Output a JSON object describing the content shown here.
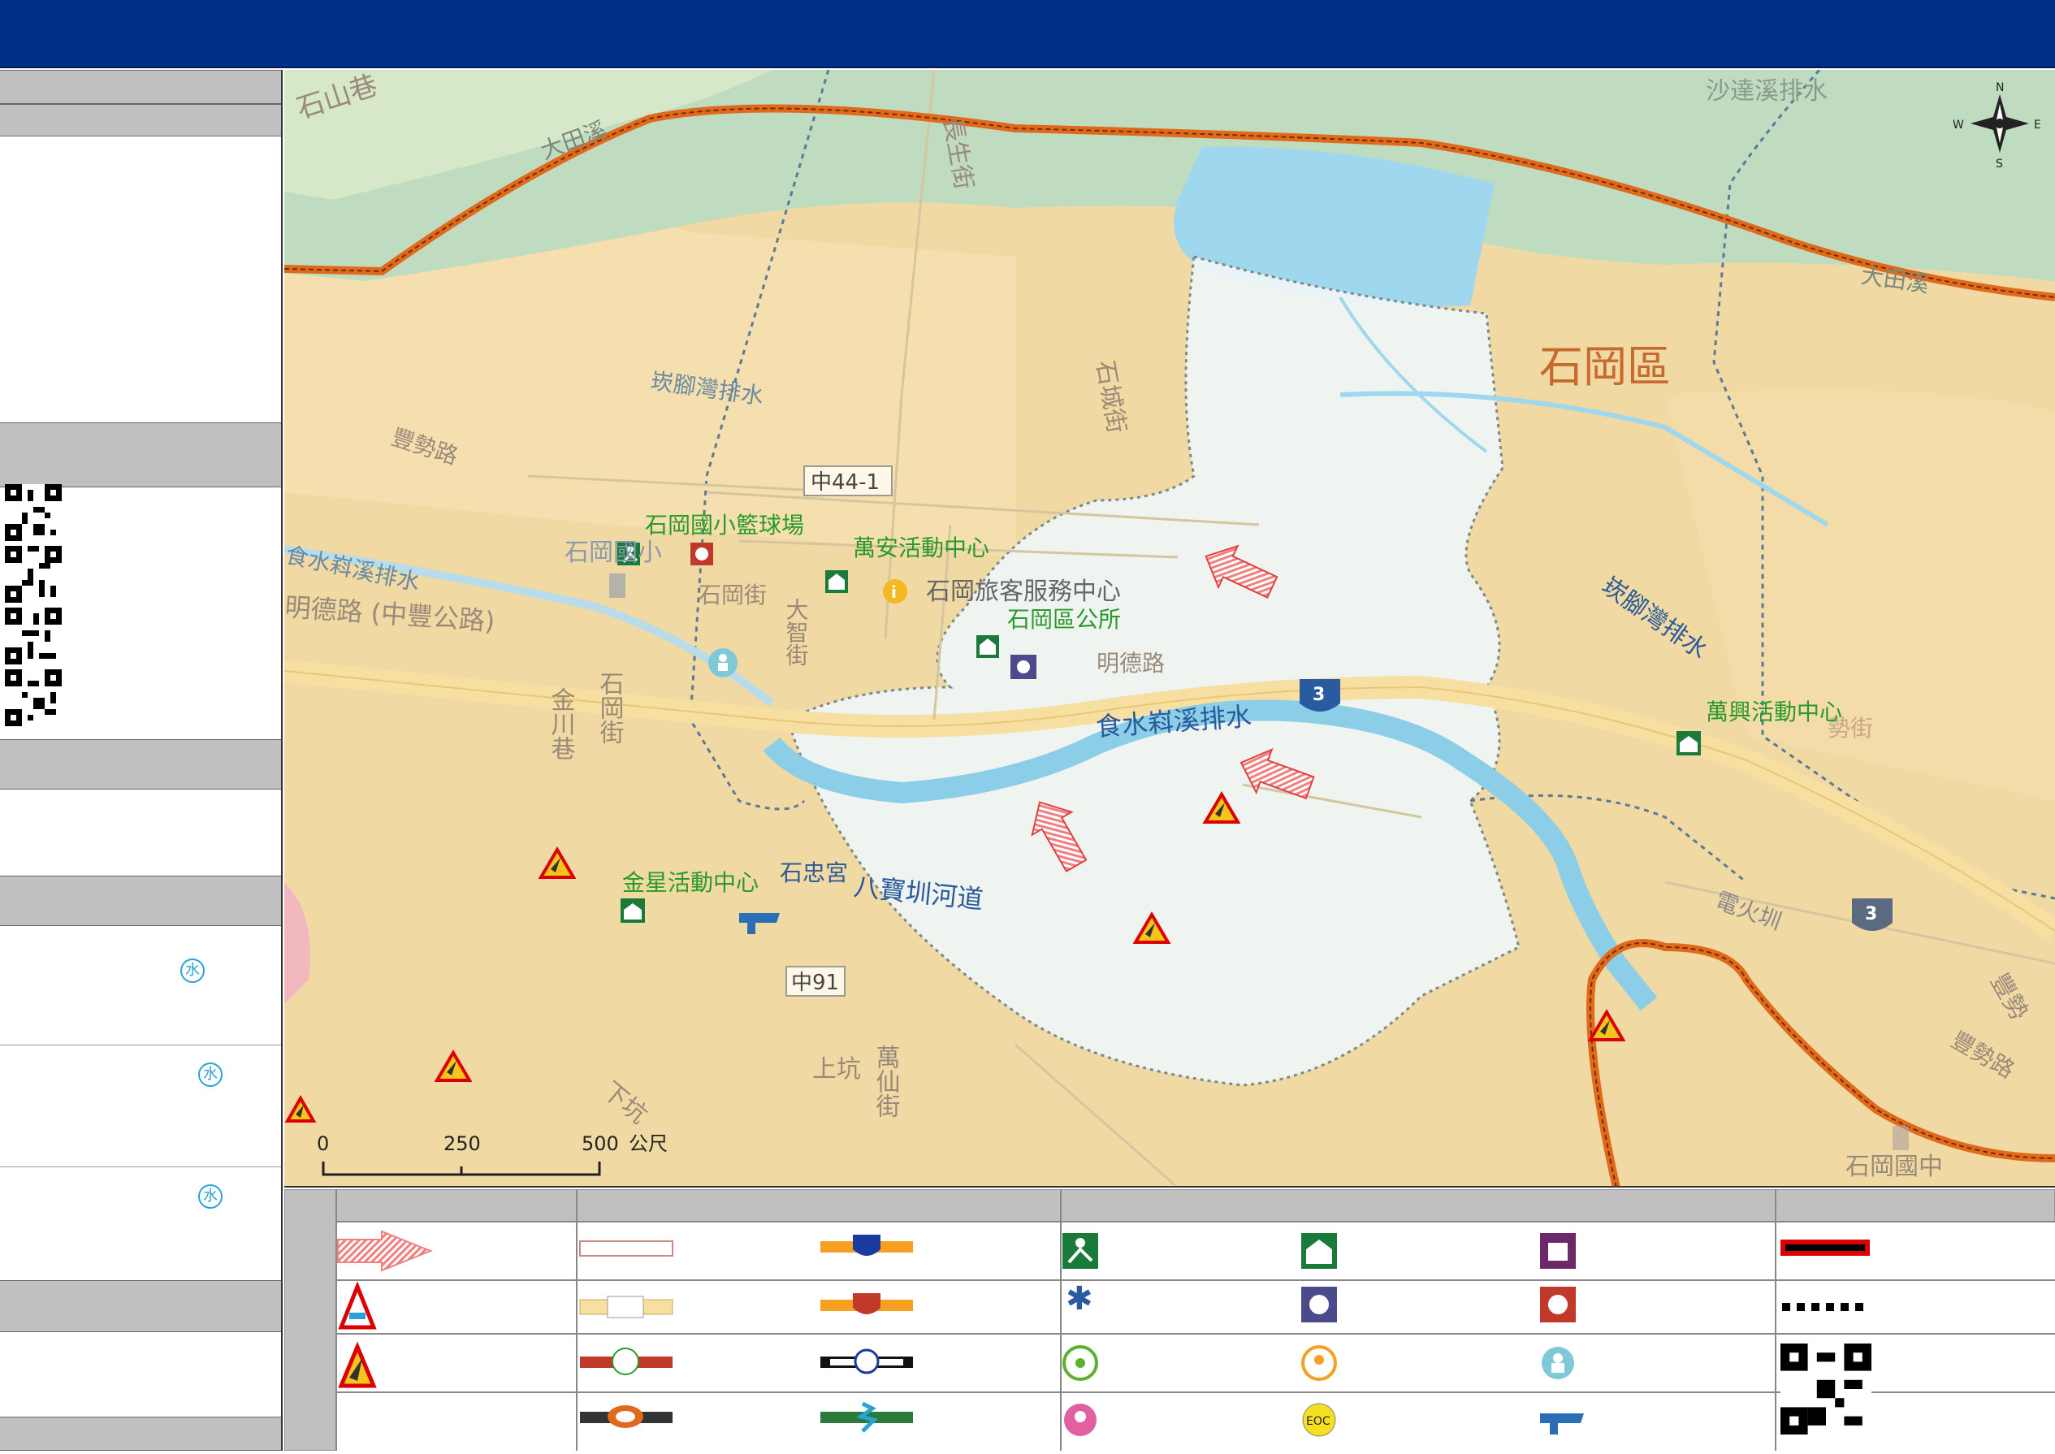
{
  "map": {
    "place_labels": {
      "shigang_district": "石岡區",
      "shishan_lane": "石山巷",
      "datian_creek_w": "大田溪",
      "datian_creek_e": "大田溪",
      "shadaxi": "沙達溪排水",
      "changsheng_st": "長生街",
      "shicheng_st": "石城街",
      "zhong44": "中44-1",
      "fengshi_rd": "豐勢路",
      "kanjiaowan_w": "崁腳灣排水",
      "kanjiaowan_e": "崁腳灣排水",
      "shishui_w": "食水嵙溪排水",
      "shishui_main": "食水嵙溪排水",
      "mingde_rd": "明德路 (中豐公路)",
      "shigang_st": "石岡街",
      "dazhi_st": "大智街",
      "jinchuan_lane": "金川巷",
      "shigang_st2": "石岡街",
      "shigang_es_partial": "石岡國小",
      "fengshi_jie": "豐勢街",
      "minglu_partial": "明德路",
      "bagua_canal": "八寶圳河道",
      "zhong91": "中91",
      "shangkeng": "上坑",
      "xiakeng": "下坑",
      "wanxian_st": "萬仙街",
      "fengshi_rd_e": "豐勢路",
      "shigang_jhs": "石岡國中",
      "dianhuo_canal": "電火圳",
      "fengshi_st_far": "豐勢",
      "route3_a": "3",
      "route3_b": "3",
      "fengshi_partial": "勢街"
    },
    "facility_labels": {
      "basketball": "石岡國小籃球場",
      "wanan": "萬安活動中心",
      "visitor": "石岡旅客服務中心",
      "office": "石岡區公所",
      "wanxing": "萬興活動中心",
      "jinxing": "金星活動中心",
      "shizhong": "石忠宮"
    },
    "compass": {
      "n": "N",
      "s": "S",
      "e": "E",
      "w": "W"
    },
    "scale": {
      "t0": "0",
      "t1": "250",
      "t2": "500",
      "unit": "公尺"
    },
    "colors": {
      "land": "#f0d9a3",
      "river": "#bfdbc0",
      "water": "#9fd8ee",
      "flood_zone": "#eef6f5",
      "boundary": "#e06a1c",
      "highway": "#f6dfa0"
    }
  },
  "legend": {
    "eoc_text": "EOC"
  }
}
